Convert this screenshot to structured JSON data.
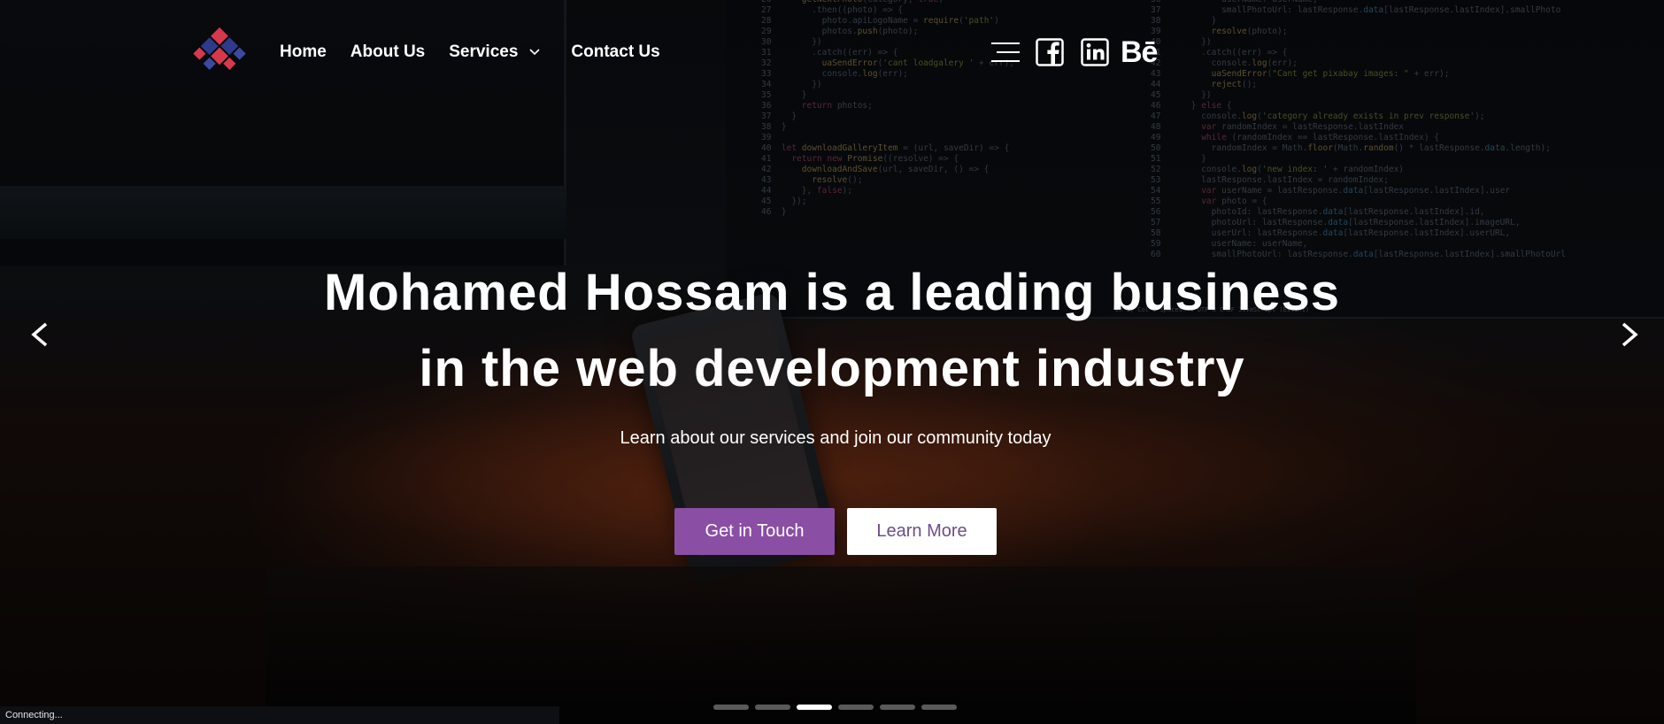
{
  "nav": {
    "home": "Home",
    "about": "About Us",
    "services": "Services",
    "contact": "Contact Us"
  },
  "social": {
    "icons": [
      "hamburger-menu-icon",
      "facebook-icon",
      "linkedin-icon",
      "behance-icon"
    ],
    "behance_label": "Bē"
  },
  "hero": {
    "headline_line1": "Mohamed Hossam is a leading business",
    "headline_line2": "in the web development industry",
    "subline": "Learn about our services and join our community today",
    "primary_button": "Get in Touch",
    "secondary_button": "Learn More"
  },
  "carousel": {
    "slide_count": 6,
    "active_index": 2
  },
  "status": {
    "text": "Connecting..."
  },
  "colors": {
    "primary_button": "#8a4ea5",
    "secondary_button_text": "#6e4c8c"
  }
}
